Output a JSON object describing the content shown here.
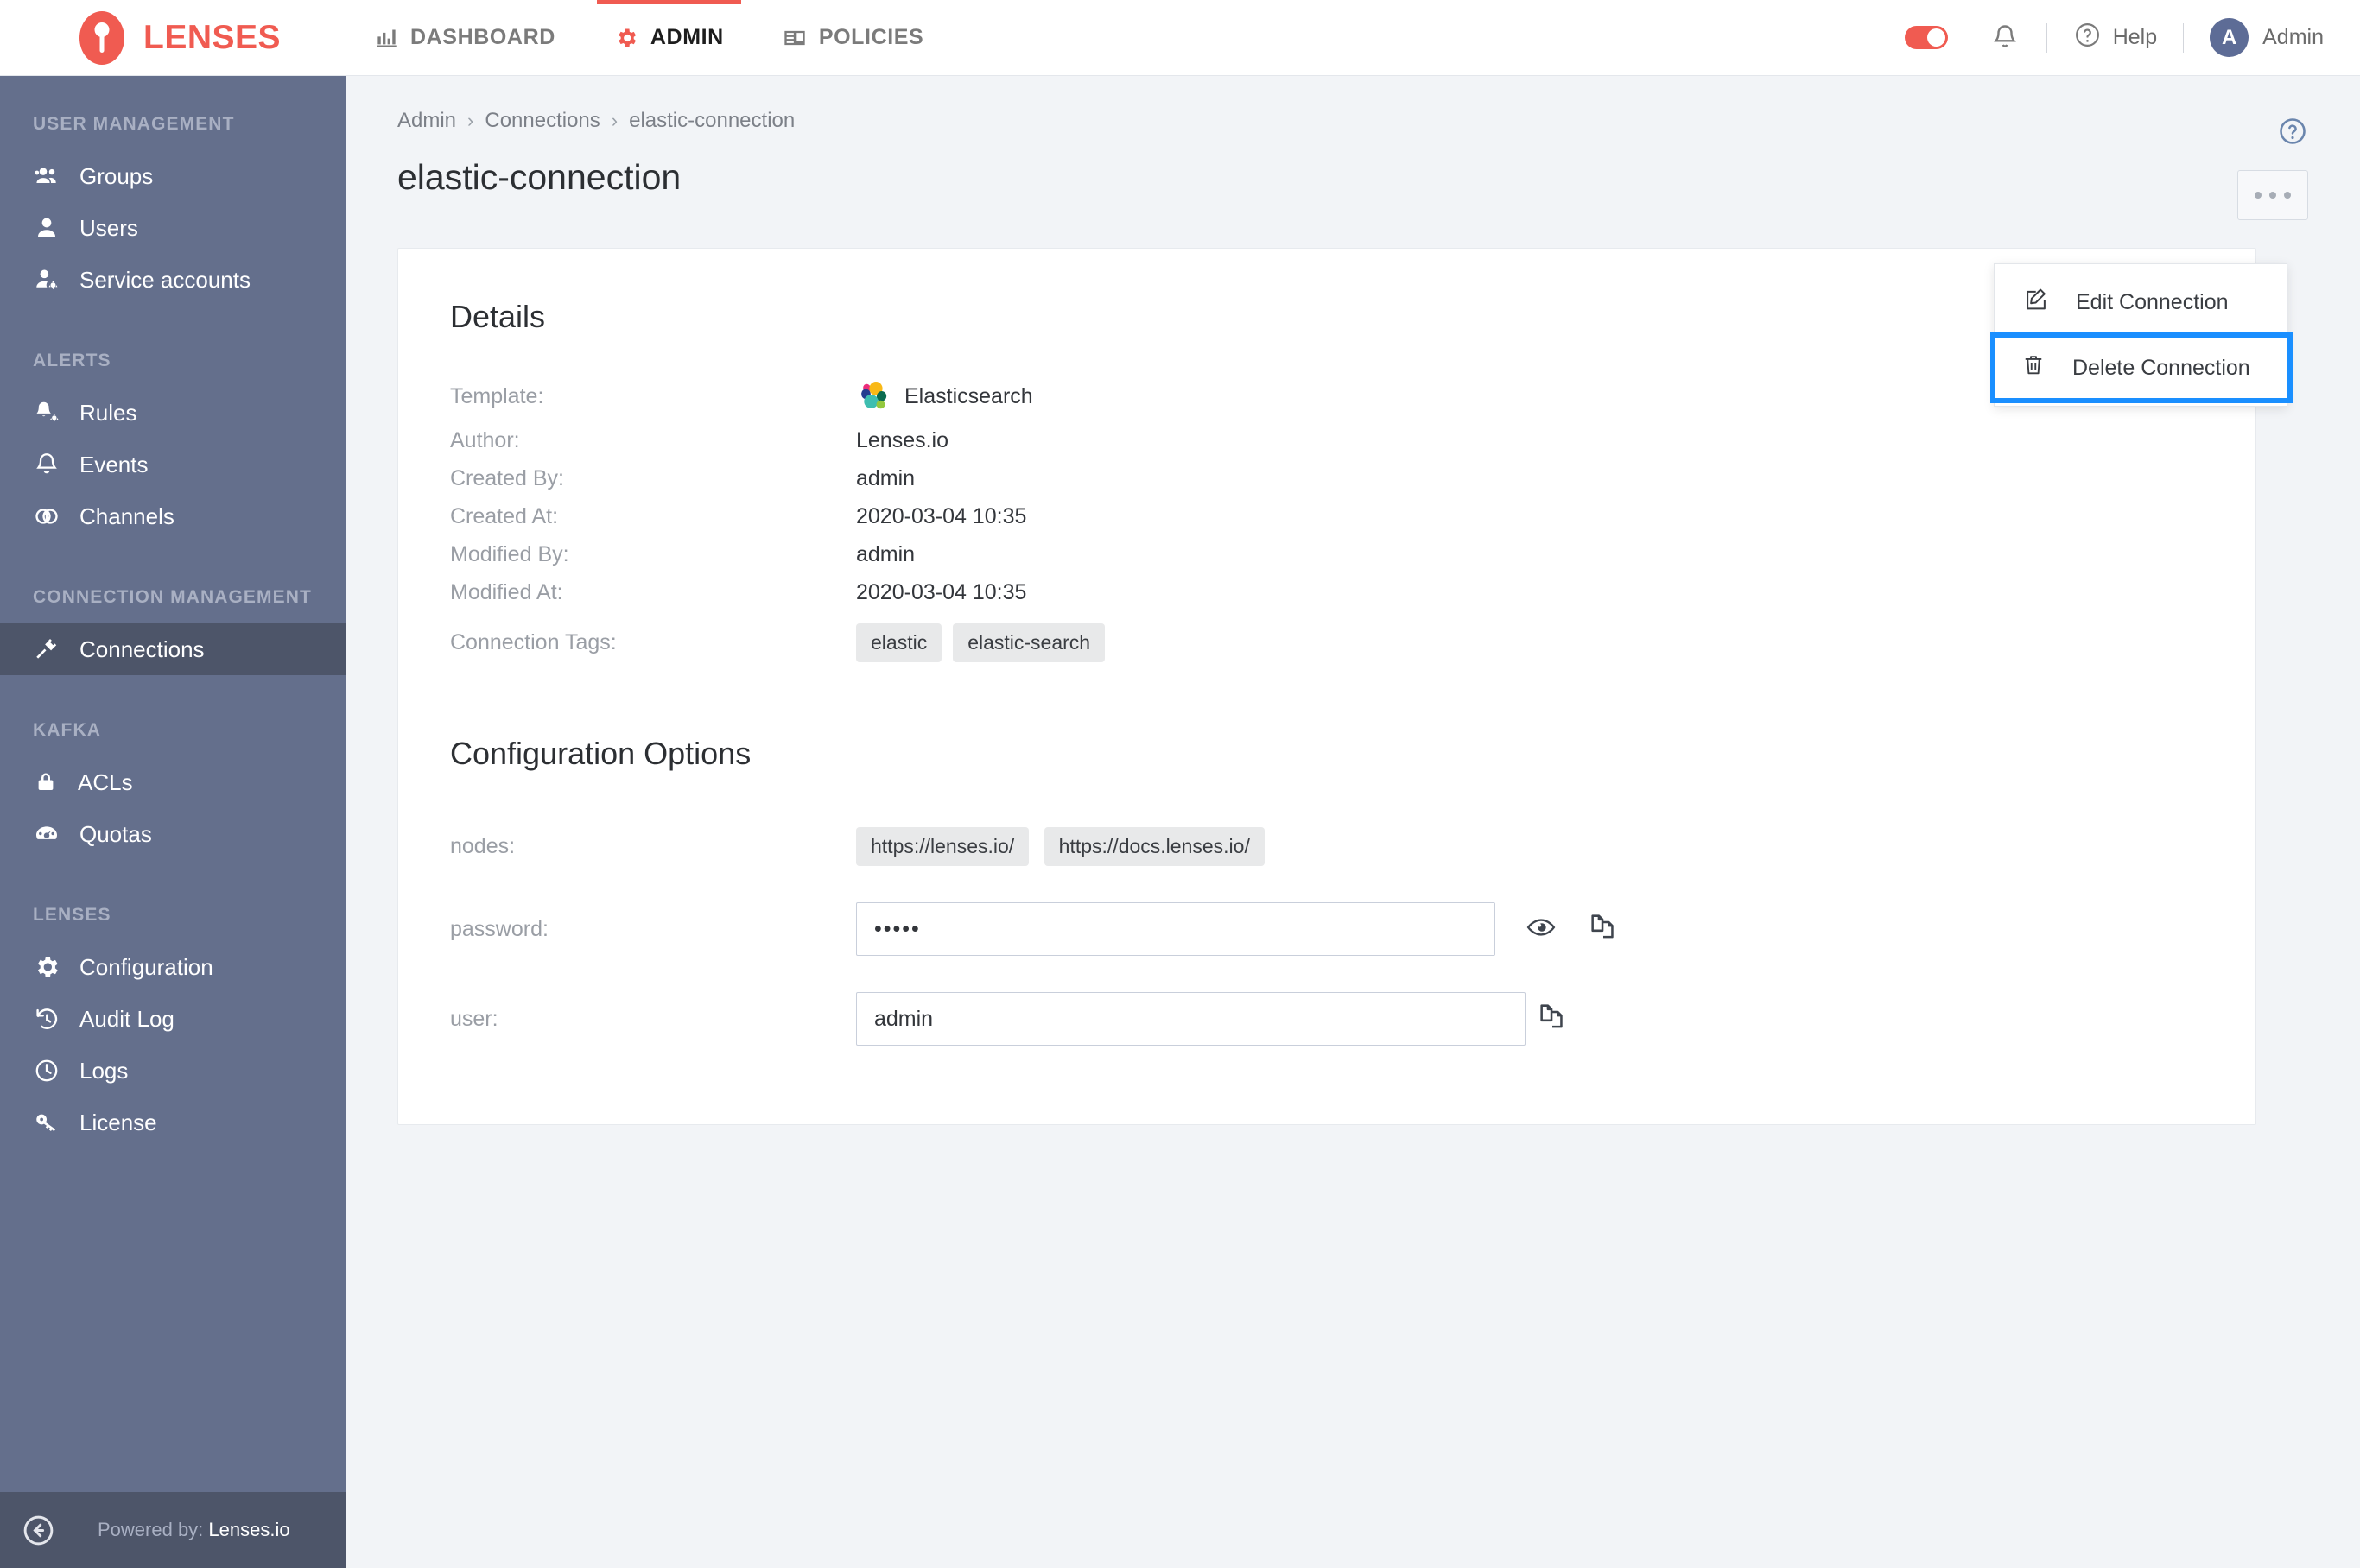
{
  "topbar": {
    "brand": "LENSES",
    "nav": [
      {
        "label": "DASHBOARD",
        "icon": "chart-bar-icon",
        "active": false
      },
      {
        "label": "ADMIN",
        "icon": "gear-icon",
        "active": true
      },
      {
        "label": "POLICIES",
        "icon": "id-card-icon",
        "active": false
      }
    ],
    "toggle_state": "on",
    "notifications_icon": "bell-icon",
    "help_label": "Help",
    "help_icon": "question-circle-icon",
    "avatar_initial": "A",
    "user_name": "Admin"
  },
  "sidebar": {
    "groups": [
      {
        "title": "USER MANAGEMENT",
        "items": [
          {
            "label": "Groups",
            "icon": "users-group-icon",
            "active": false
          },
          {
            "label": "Users",
            "icon": "user-icon",
            "active": false
          },
          {
            "label": "Service accounts",
            "icon": "user-gear-icon",
            "active": false
          }
        ]
      },
      {
        "title": "ALERTS",
        "items": [
          {
            "label": "Rules",
            "icon": "bell-gear-icon",
            "active": false
          },
          {
            "label": "Events",
            "icon": "bell-icon",
            "active": false
          },
          {
            "label": "Channels",
            "icon": "channels-icon",
            "active": false
          }
        ]
      },
      {
        "title": "CONNECTION MANAGEMENT",
        "items": [
          {
            "label": "Connections",
            "icon": "plug-icon",
            "active": true
          }
        ]
      },
      {
        "title": "KAFKA",
        "items": [
          {
            "label": "ACLs",
            "icon": "lock-icon",
            "active": false
          },
          {
            "label": "Quotas",
            "icon": "gauge-icon",
            "active": false
          }
        ]
      },
      {
        "title": "LENSES",
        "items": [
          {
            "label": "Configuration",
            "icon": "gear-icon",
            "active": false
          },
          {
            "label": "Audit Log",
            "icon": "history-icon",
            "active": false
          },
          {
            "label": "Logs",
            "icon": "clock-icon",
            "active": false
          },
          {
            "label": "License",
            "icon": "key-icon",
            "active": false
          }
        ]
      }
    ],
    "footer": {
      "collapse_icon": "arrow-circle-left-icon",
      "powered_prefix": "Powered by:",
      "powered_name": "Lenses.io"
    }
  },
  "main": {
    "breadcrumb": [
      "Admin",
      "Connections",
      "elastic-connection"
    ],
    "breadcrumb_separator": "›",
    "page_title": "elastic-connection",
    "help_icon": "question-circle-icon",
    "actions_button_icon": "kebab-menu-icon",
    "dropdown": {
      "items": [
        {
          "label": "Edit Connection",
          "icon": "pencil-square-icon",
          "highlighted": false
        },
        {
          "label": "Delete Connection",
          "icon": "trash-icon",
          "highlighted": true
        }
      ],
      "highlight_color": "#1a8fff"
    },
    "details": {
      "title": "Details",
      "template_label": "Template:",
      "template_value": "Elasticsearch",
      "template_icon": "elasticsearch-logo",
      "rows": [
        {
          "label": "Author:",
          "value": "Lenses.io"
        },
        {
          "label": "Created By:",
          "value": "admin"
        },
        {
          "label": "Created At:",
          "value": "2020-03-04 10:35"
        },
        {
          "label": "Modified By:",
          "value": "admin"
        },
        {
          "label": "Modified At:",
          "value": "2020-03-04 10:35"
        }
      ],
      "tags_label": "Connection Tags:",
      "tags": [
        "elastic",
        "elastic-search"
      ]
    },
    "configuration": {
      "title": "Configuration Options",
      "nodes_label": "nodes:",
      "nodes": [
        "https://lenses.io/",
        "https://docs.lenses.io/"
      ],
      "password_label": "password:",
      "password_value": "•••••",
      "password_reveal_icon": "eye-icon",
      "password_copy_icon": "copy-icon",
      "user_label": "user:",
      "user_value": "admin",
      "user_copy_icon": "copy-icon"
    }
  },
  "colors": {
    "brand_red": "#f05b51",
    "sidebar": "#646f8c",
    "sidebar_active": "#4d5569",
    "highlight_blue": "#1a8fff",
    "avatar": "#5d6c96"
  }
}
